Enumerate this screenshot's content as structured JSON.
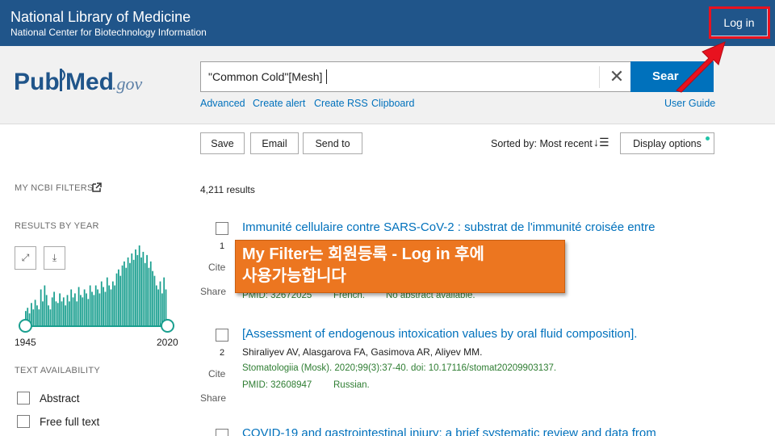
{
  "header": {
    "org_title": "National Library of Medicine",
    "org_subtitle": "National Center for Biotechnology Information",
    "login_label": "Log in"
  },
  "logo": {
    "pub": "Pub",
    "med": "Med",
    "gov": ".gov"
  },
  "search": {
    "value": "\"Common Cold\"[Mesh]",
    "button_label": "Search",
    "button_visible_label": "Sear",
    "links": [
      "Advanced",
      "Create alert",
      "Create RSS",
      "Clipboard"
    ],
    "user_guide": "User Guide"
  },
  "toolbar": {
    "save": "Save",
    "email": "Email",
    "send_to": "Send to",
    "sorted_by": "Sorted by: Most recent",
    "display_options": "Display options"
  },
  "sidebar": {
    "my_filters": "MY NCBI FILTERS",
    "results_by_year": "RESULTS BY YEAR",
    "year_start": "1945",
    "year_end": "2020",
    "histogram": {
      "color": "#1a9f8f",
      "relative_counts": [
        0.18,
        0.22,
        0.15,
        0.28,
        0.2,
        0.32,
        0.25,
        0.2,
        0.45,
        0.3,
        0.5,
        0.38,
        0.25,
        0.2,
        0.35,
        0.42,
        0.3,
        0.28,
        0.4,
        0.3,
        0.35,
        0.25,
        0.38,
        0.3,
        0.45,
        0.35,
        0.4,
        0.3,
        0.48,
        0.38,
        0.35,
        0.45,
        0.4,
        0.33,
        0.5,
        0.42,
        0.38,
        0.5,
        0.45,
        0.4,
        0.55,
        0.48,
        0.42,
        0.6,
        0.5,
        0.45,
        0.55,
        0.5,
        0.65,
        0.7,
        0.62,
        0.75,
        0.8,
        0.72,
        0.85,
        0.78,
        0.9,
        0.82,
        0.95,
        0.88,
        1.0,
        0.85,
        0.92,
        0.78,
        0.88,
        0.72,
        0.8,
        0.68,
        0.62,
        0.5,
        0.45,
        0.55,
        0.4,
        0.6,
        0.45
      ]
    },
    "text_availability": "TEXT AVAILABILITY",
    "filters": [
      "Abstract",
      "Free full text"
    ]
  },
  "results": {
    "count": "4,211 results",
    "items": [
      {
        "num": "1",
        "title": "Immunité cellulaire contre SARS-CoV-2 : substrat de l'immunité croisée entre",
        "pmid": "PMID: 32672025",
        "language": "French.",
        "note": "No abstract available."
      },
      {
        "num": "2",
        "title": "[Assessment of endogenous intoxication values by oral fluid composition].",
        "authors": "Shiraliyev AV, Alasgarova FA, Gasimova AR, Aliyev MM.",
        "citation": "Stomatologiia (Mosk). 2020;99(3):37-40. doi: 10.17116/stomat20209903137.",
        "pmid": "PMID: 32608947",
        "language": "Russian."
      },
      {
        "title": "COVID-19 and gastrointestinal injury: a brief systematic review and data from"
      }
    ],
    "cite": "Cite",
    "share": "Share"
  },
  "callout": {
    "line1": "My Filter는 회원등록 - Log in 후에",
    "line2": "사용가능합니다"
  },
  "colors": {
    "nlm_bar": "#20558a",
    "link": "#0071bc",
    "callout": "#ec7620",
    "highlight": "#e8121f"
  }
}
